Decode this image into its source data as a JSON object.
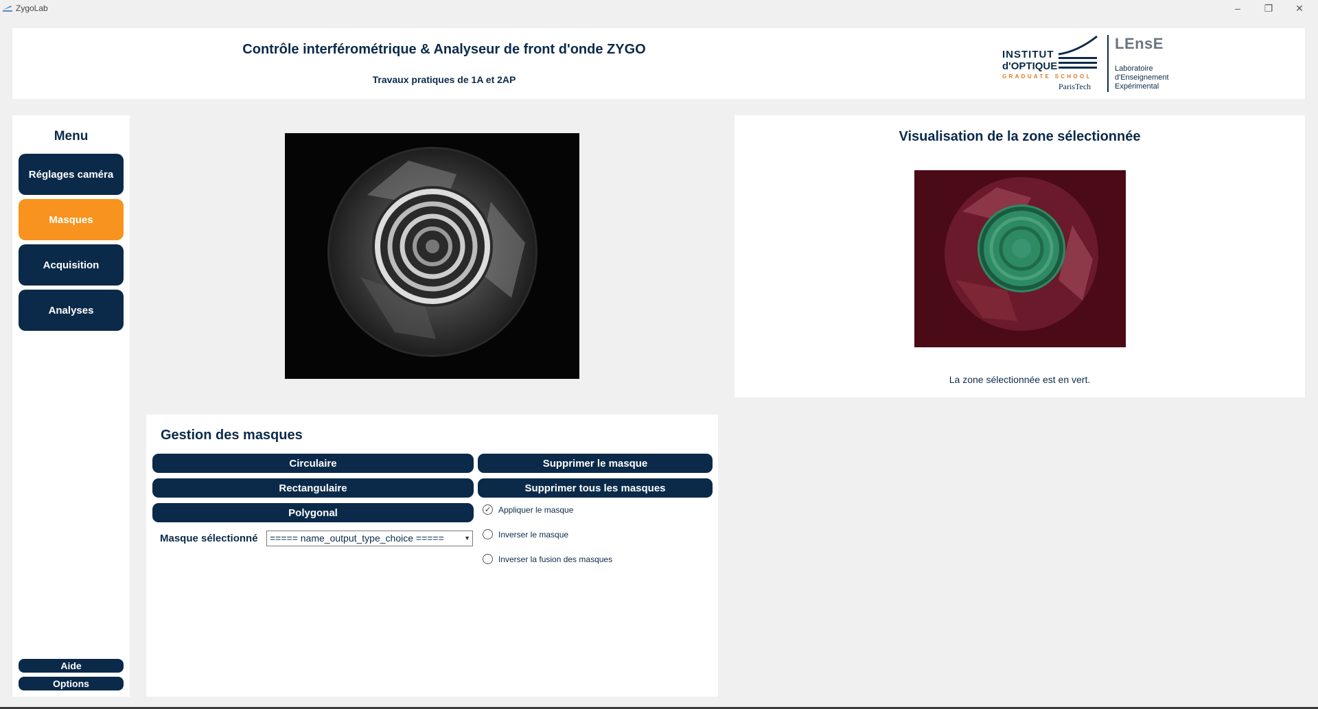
{
  "window": {
    "title": "ZygoLab",
    "controls": [
      "minimize-icon",
      "restore-icon",
      "close-icon"
    ]
  },
  "header": {
    "title": "Contrôle interférométrique & Analyseur de front d'onde ZYGO",
    "subtitle": "Travaux pratiques de 1A et 2AP",
    "logo_io": {
      "line1": "INSTITUT",
      "line2": "d'OPTIQUE",
      "line3": "GRADUATE SCHOOL",
      "line4": "ParisTech"
    },
    "logo_lense": {
      "name": "LEnsE",
      "line1": "Laboratoire",
      "line2": "d'Enseignement",
      "line3": "Expérimental"
    }
  },
  "sidebar": {
    "title": "Menu",
    "items": [
      {
        "label": "Réglages caméra",
        "active": false
      },
      {
        "label": "Masques",
        "active": true
      },
      {
        "label": "Acquisition",
        "active": false
      },
      {
        "label": "Analyses",
        "active": false
      }
    ],
    "help_label": "Aide",
    "options_label": "Options"
  },
  "mask_panel": {
    "title": "Gestion des masques",
    "buttons": {
      "circular": "Circulaire",
      "rectangular": "Rectangulaire",
      "polygonal": "Polygonal",
      "delete_mask": "Supprimer le masque",
      "delete_all": "Supprimer tous les masques"
    },
    "selected_label": "Masque sélectionné",
    "selected_value": "===== name_output_type_choice =====",
    "checkboxes": [
      {
        "label": "Appliquer le masque",
        "checked": true
      },
      {
        "label": "Inverser le masque",
        "checked": false
      },
      {
        "label": "Inverser la fusion des masques",
        "checked": false
      }
    ]
  },
  "visualization": {
    "title": "Visualisation de la zone sélectionnée",
    "caption": "La zone sélectionnée est en vert."
  },
  "colors": {
    "navy": "#0b2a4a",
    "accent_orange": "#f7931e",
    "background": "#f0f0f0",
    "mask_outside": "#4a0a16",
    "mask_selected": "#2e8a63"
  }
}
